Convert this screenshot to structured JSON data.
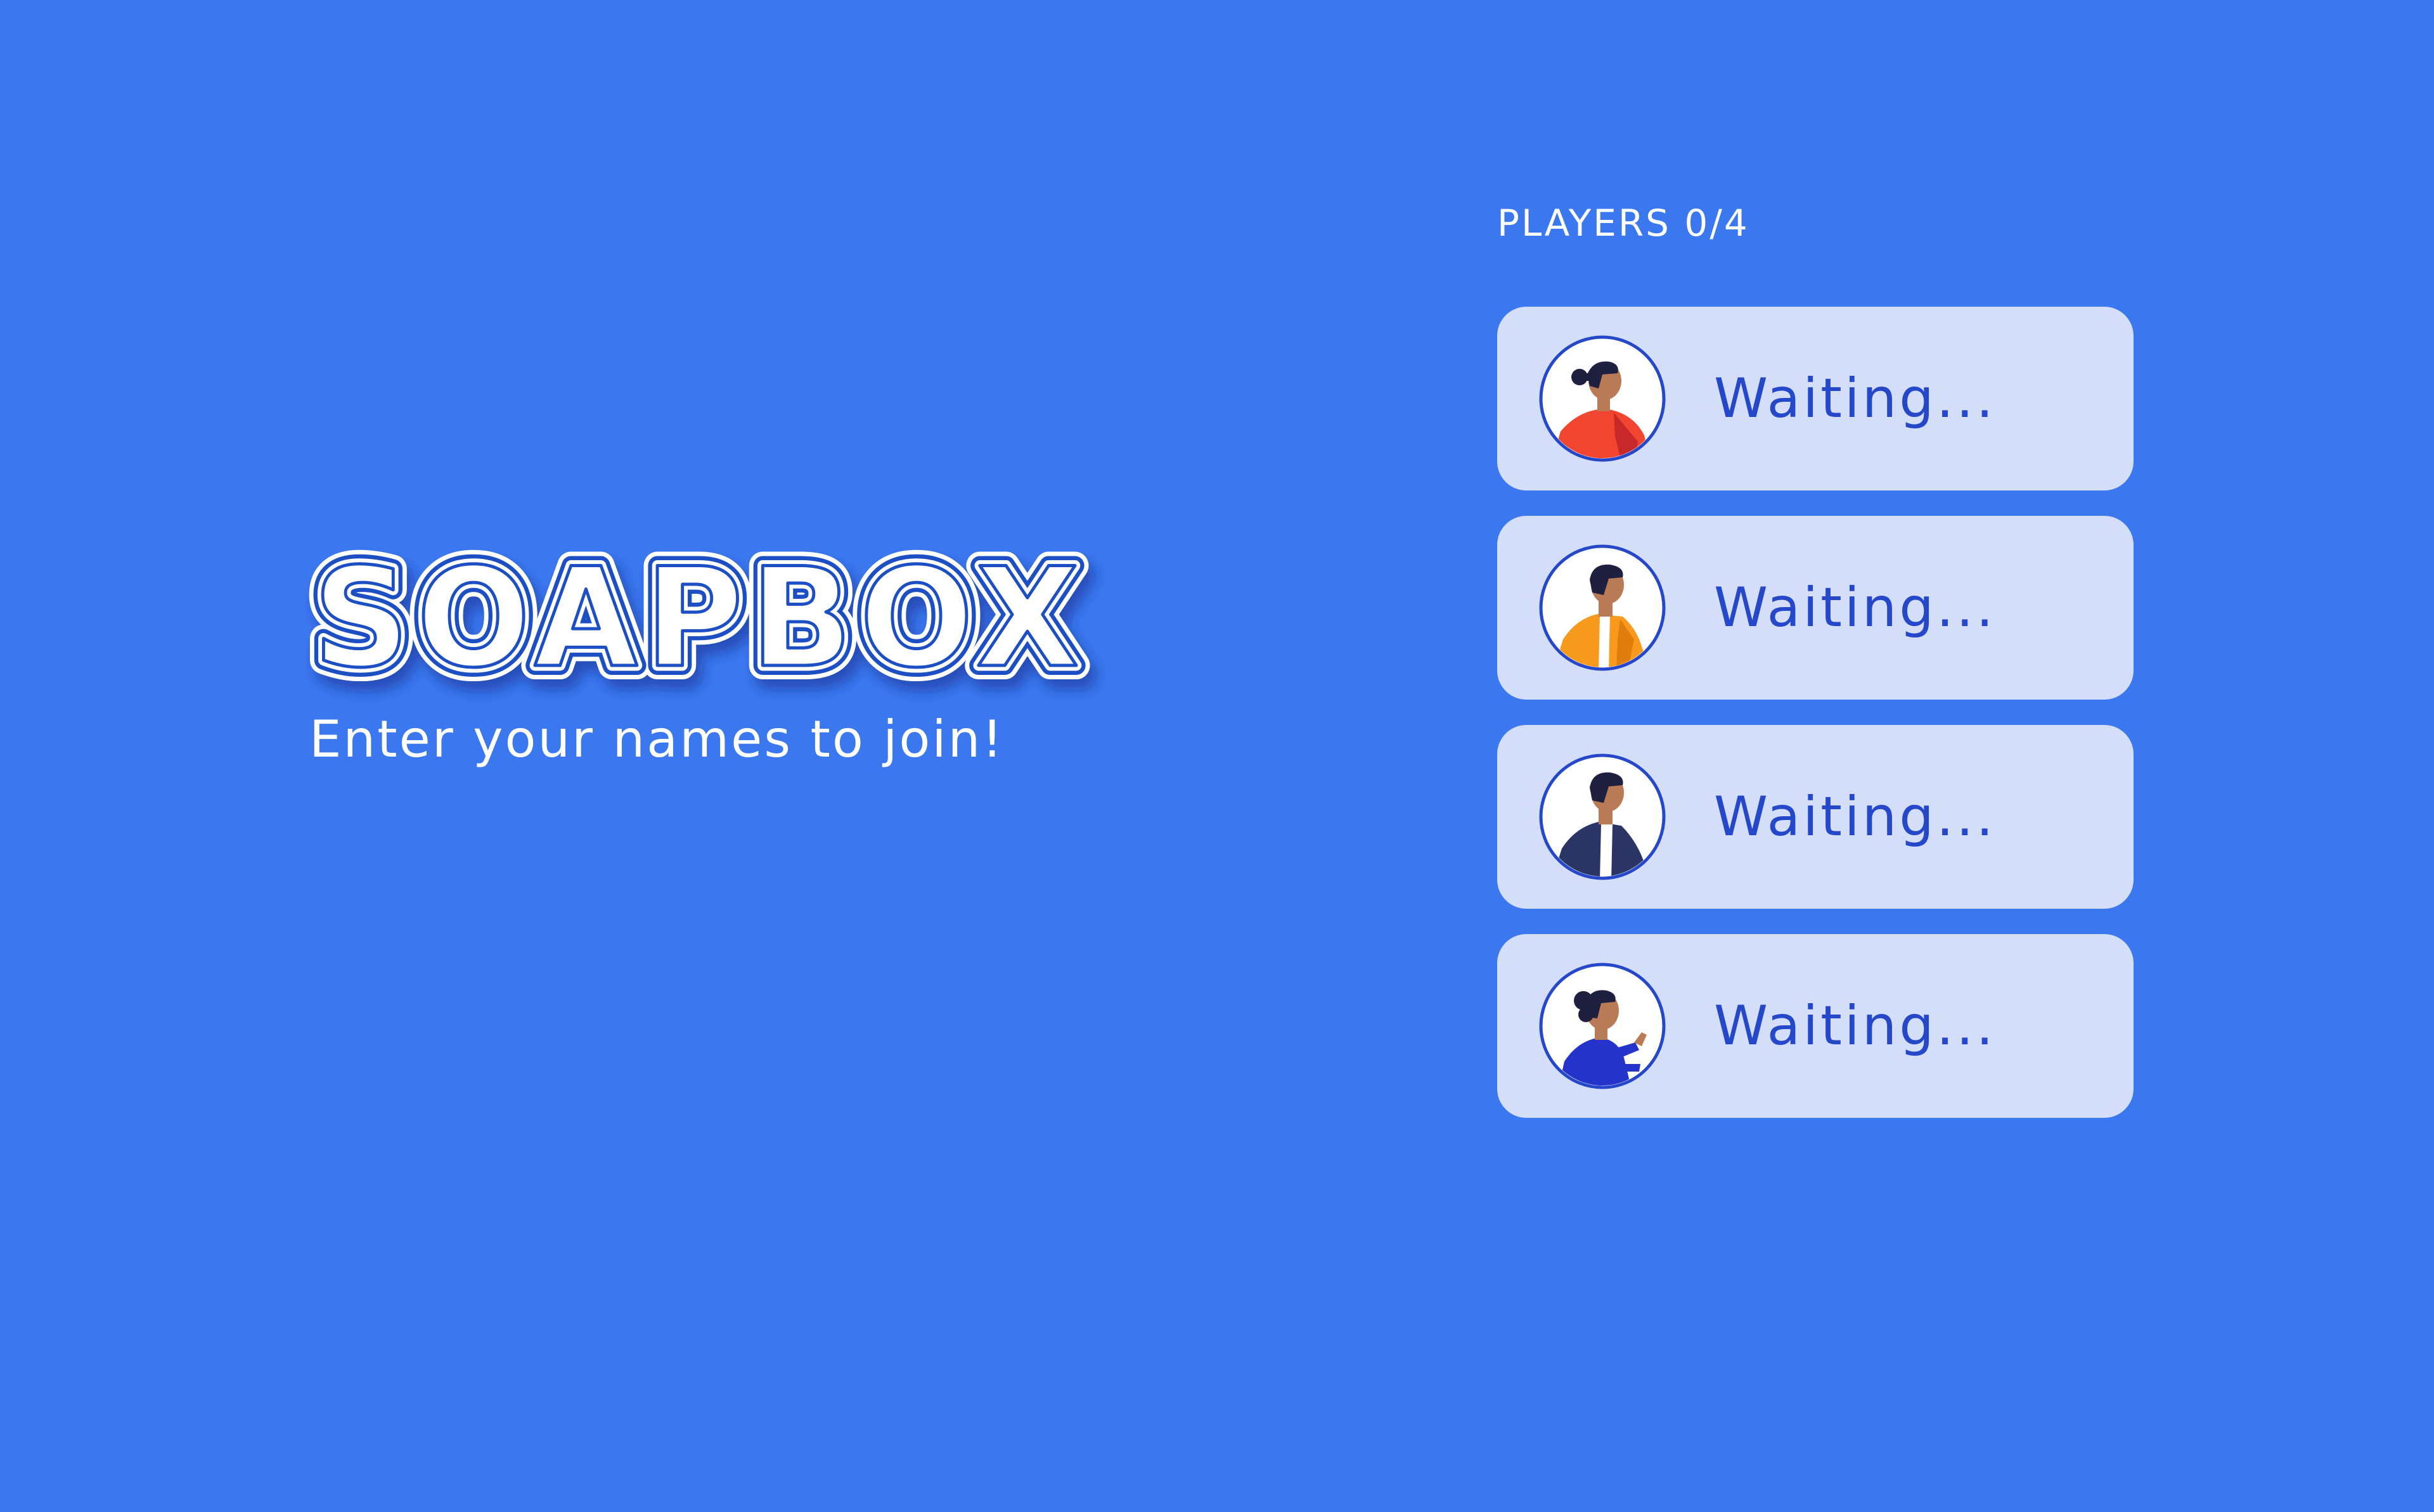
{
  "game": {
    "title": "SOAPBOX",
    "subtitle": "Enter your names to join!"
  },
  "players": {
    "heading": "PLAYERS 0/4",
    "slots": [
      {
        "status": "Waiting...",
        "avatar": "woman-red-jacket-avatar",
        "jacket_color": "#f2452f"
      },
      {
        "status": "Waiting...",
        "avatar": "man-orange-jacket-avatar",
        "jacket_color": "#f79a1e"
      },
      {
        "status": "Waiting...",
        "avatar": "man-navy-jacket-avatar",
        "jacket_color": "#2a3566"
      },
      {
        "status": "Waiting...",
        "avatar": "woman-blue-sweater-avatar",
        "jacket_color": "#2433c9"
      }
    ]
  },
  "colors": {
    "background": "#3b78ef",
    "slot_background": "#d4def9",
    "slot_text": "#2448c9",
    "logo_outline": "#1e4fc4"
  }
}
